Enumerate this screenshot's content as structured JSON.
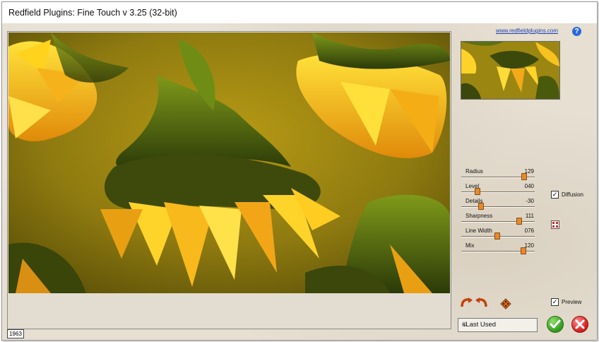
{
  "window": {
    "title": "Redfield Plugins: Fine Touch v 3.25 (32-bit)"
  },
  "header": {
    "link_text": "www.redfieldplugins.com",
    "help_label": "?"
  },
  "sliders": [
    {
      "label": "Radius",
      "value": "129",
      "fraction": 0.86
    },
    {
      "label": "Level",
      "value": "040",
      "fraction": 0.22
    },
    {
      "label": "Details",
      "value": "-30",
      "fraction": 0.27
    },
    {
      "label": "Sharpness",
      "value": "111",
      "fraction": 0.79
    },
    {
      "label": "Line Width",
      "value": "076",
      "fraction": 0.49
    },
    {
      "label": "Mix",
      "value": "120",
      "fraction": 0.85
    }
  ],
  "options": {
    "diffusion": {
      "label": "Diffusion",
      "checked": true
    },
    "preview": {
      "label": "Preview",
      "checked": true
    }
  },
  "preset": {
    "selected": "#Last Used"
  },
  "status": {
    "counter": "1963"
  },
  "icons": {
    "help": "help-icon",
    "undo": "undo-icon",
    "redo": "redo-icon",
    "reset": "reset-icon",
    "grid": "grid-icon",
    "ok": "ok-check-icon",
    "cancel": "cancel-x-icon",
    "dropdown": "chevron-down-icon"
  },
  "colors": {
    "accent_orange": "#e58a2c",
    "ok_green": "#2f9a1c",
    "cancel_red": "#d21a1a",
    "link_blue": "#1f3fb0"
  }
}
